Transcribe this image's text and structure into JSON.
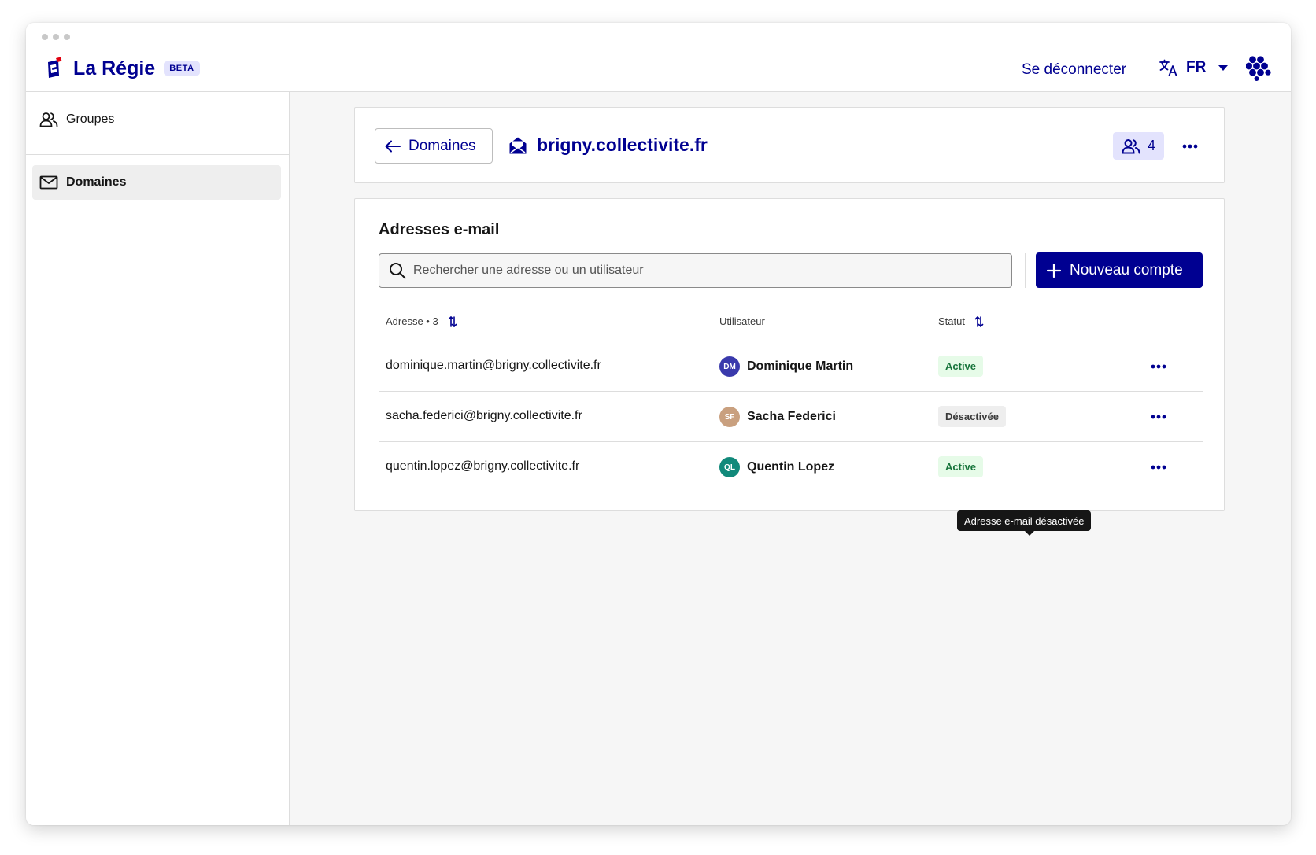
{
  "app": {
    "name": "La Régie",
    "badge": "BETA"
  },
  "header": {
    "logout_label": "Se déconnecter",
    "language": "FR"
  },
  "sidebar": {
    "items": [
      {
        "label": "Groupes",
        "icon": "users-icon",
        "active": false
      },
      {
        "label": "Domaines",
        "icon": "mail-icon",
        "active": true
      }
    ]
  },
  "domain": {
    "back_label": "Domaines",
    "name": "brigny.collectivite.fr",
    "members_count": "4"
  },
  "emails": {
    "title": "Adresses e-mail",
    "search_placeholder": "Rechercher une adresse ou un utilisateur",
    "new_button_label": "Nouveau compte",
    "columns": {
      "address": "Adresse • 3",
      "user": "Utilisateur",
      "status": "Statut"
    },
    "rows": [
      {
        "address": "dominique.martin@brigny.collectivite.fr",
        "initials": "DM",
        "user": "Dominique Martin",
        "status": "Active",
        "avatar_color": "#3a3aac"
      },
      {
        "address": "sacha.federici@brigny.collectivite.fr",
        "initials": "SF",
        "user": "Sacha Federici",
        "status": "Désactivée",
        "avatar_color": "#c9a07f"
      },
      {
        "address": "quentin.lopez@brigny.collectivite.fr",
        "initials": "QL",
        "user": "Quentin Lopez",
        "status": "Active",
        "avatar_color": "#11897a"
      }
    ],
    "tooltip": "Adresse e-mail désactivée"
  },
  "colors": {
    "primary": "#000091",
    "active_bg": "#e6fbe8",
    "active_text": "#18753c",
    "inactive_bg": "#eeeeee"
  }
}
